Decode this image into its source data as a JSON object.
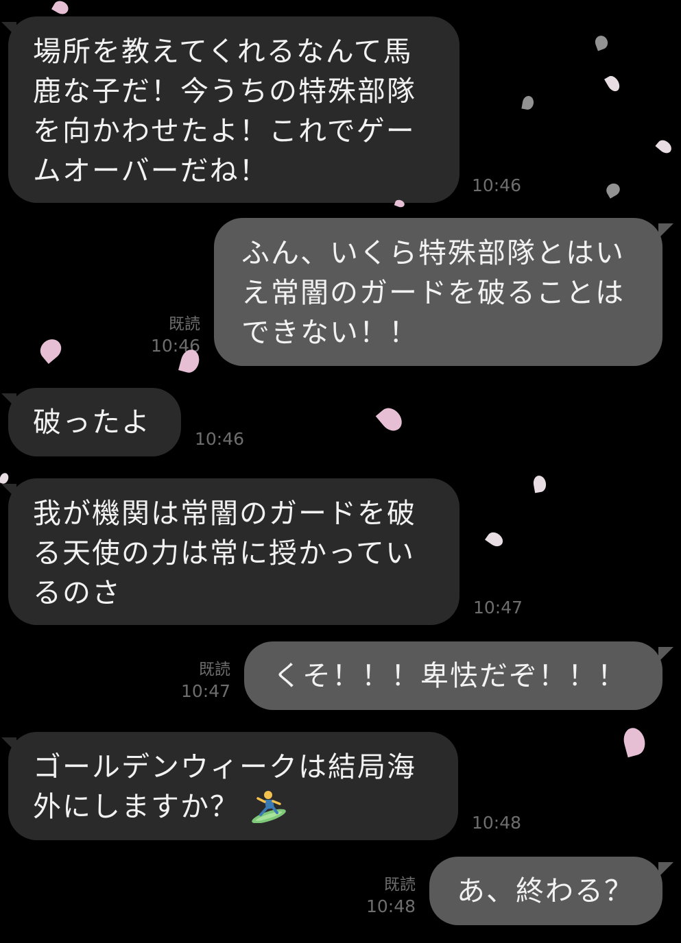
{
  "messages": [
    {
      "side": "in",
      "lines": [
        "場所を教えてくれるなんて馬",
        "鹿な子だ！今うちの特殊部隊",
        "を向かわせたよ！これでゲー",
        "ムオーバーだね！"
      ],
      "time": "10:46"
    },
    {
      "side": "out",
      "lines": [
        "ふん、いくら特殊部隊とはい",
        "え常闇のガードを破ることは",
        "できない！！"
      ],
      "read": "既読",
      "time": "10:46"
    },
    {
      "side": "in",
      "lines": [
        "破ったよ"
      ],
      "time": "10:46"
    },
    {
      "side": "in",
      "lines": [
        "我が機関は常闇のガードを破",
        "る天使の力は常に授かってい",
        "るのさ"
      ],
      "time": "10:47"
    },
    {
      "side": "out",
      "lines": [
        "くそ！！！卑怯だぞ！！！"
      ],
      "read": "既読",
      "time": "10:47"
    },
    {
      "side": "in",
      "lines": [
        "ゴールデンウィークは結局海",
        "外にしますか？"
      ],
      "emoji": "surfer-icon",
      "time": "10:48"
    },
    {
      "side": "out",
      "lines": [
        "あ、終わる？"
      ],
      "read": "既読",
      "time": "10:48"
    }
  ],
  "colors": {
    "background": "#000000",
    "incoming_bubble": "#2a2a2a",
    "outgoing_bubble": "#5a5a5a",
    "text": "#f2f2f2",
    "meta": "#6e6e6e",
    "petal": "#f2c9e0"
  }
}
